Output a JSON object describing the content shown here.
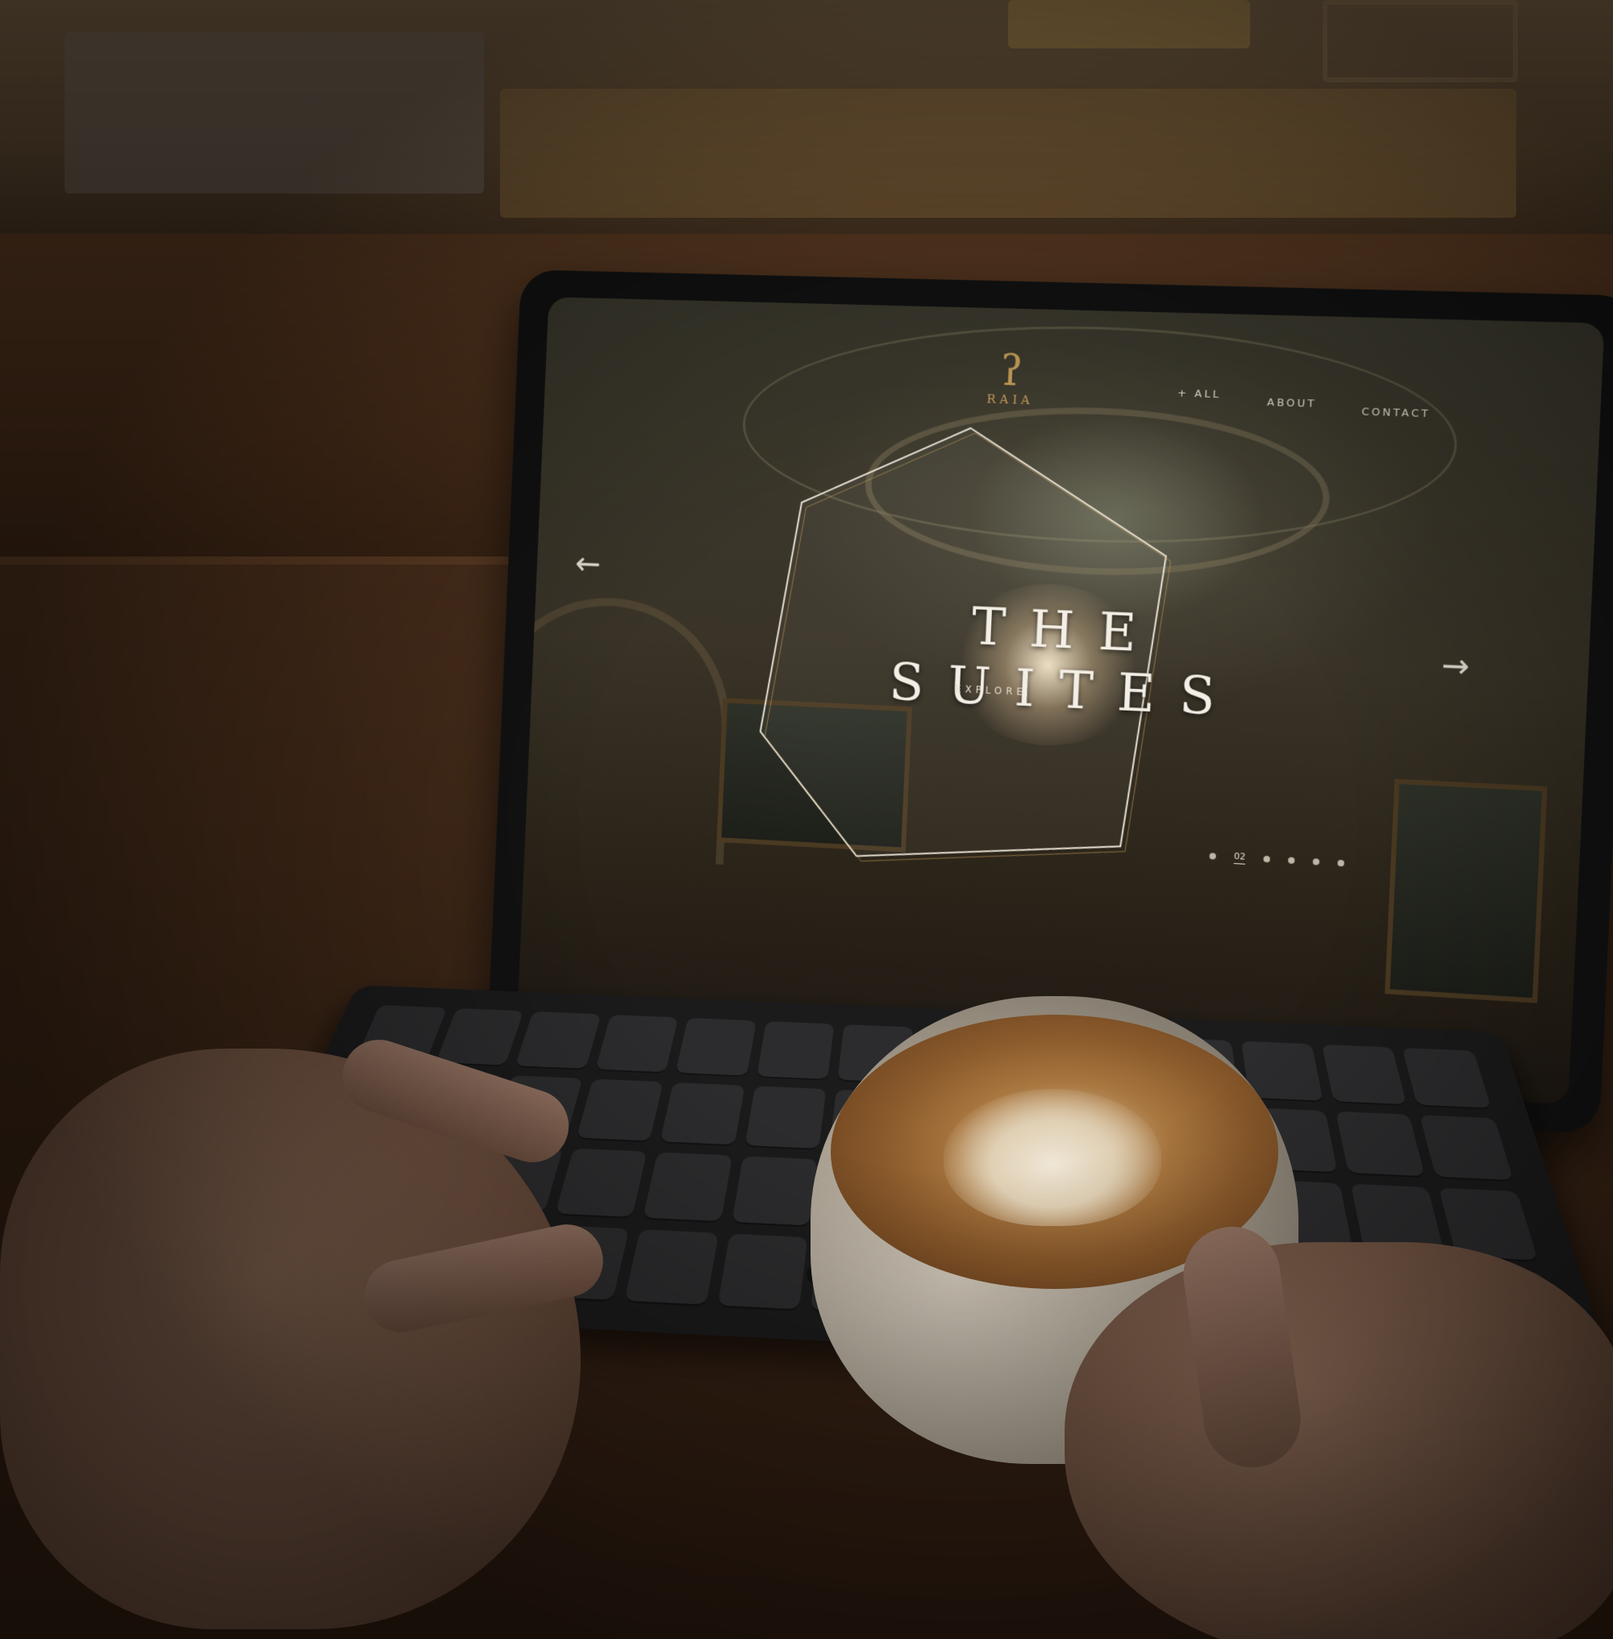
{
  "site": {
    "logo_mark": "ʔ",
    "logo_text": "RAIA",
    "nav": {
      "all": "+ ALL",
      "about": "ABOUT",
      "contact": "CONTACT"
    },
    "hero_title": "THE SUITES",
    "explore_label": "EXPLORE",
    "prev_arrow": "←",
    "next_arrow": "→",
    "pager": {
      "current": "02",
      "dots_after": 4
    }
  },
  "colors": {
    "brand_gold": "#c9a15a",
    "text_light": "#f4efe6"
  },
  "icons": {
    "prev": "arrow-left-icon",
    "next": "arrow-right-icon",
    "logo": "raia-logo-icon"
  }
}
